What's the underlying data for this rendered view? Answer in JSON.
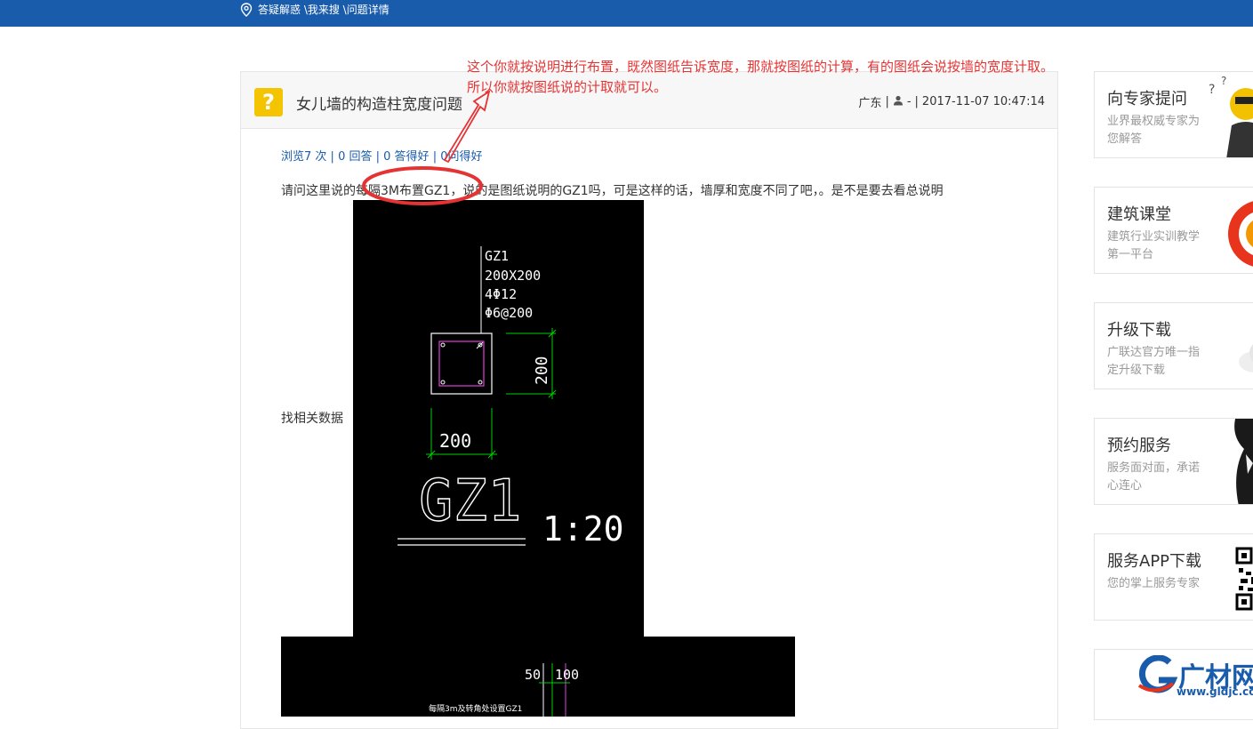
{
  "breadcrumb": {
    "text": "答疑解惑 \\我来搜 \\问题详情"
  },
  "question": {
    "title": "女儿墙的构造柱宽度问题",
    "meta": {
      "location": "广东",
      "sep1": "|",
      "user": "-",
      "sep2": "|",
      "datetime": "2017-11-07 10:47:14"
    },
    "stats": {
      "views": "浏览7 次",
      "answers": "0 回答",
      "good_answers": "0 答得好",
      "asked_good": "0问得好",
      "sep": "|"
    },
    "body_line1": "请问这里说的每隔3M布置GZ1，说的是图纸说明的GZ1吗，可是这样的话，墙厚和宽度不同了吧，。是不是要去看总说明",
    "body_line2": "找相关数据"
  },
  "cad_drawing": {
    "label_name": "GZ1",
    "label_size": "200X200",
    "label_bars": "4Φ12",
    "label_stirrup": "Φ6@200",
    "dim_vertical": "200",
    "dim_horizontal": "200",
    "big_title": "GZ1",
    "scale": "1:20",
    "dim2_a": "50",
    "dim2_b": "100",
    "note2": "每隔3m及转角处设置GZ1"
  },
  "annotation": {
    "line1": "这个你就按说明进行布置，既然图纸告诉宽度，那就按图纸的计算，有的图纸会说按墙的宽度计取。",
    "line2": "所以你就按图纸说的计取就可以。"
  },
  "sidebar": [
    {
      "title": "向专家提问",
      "desc": "业界最权威专家为您解答"
    },
    {
      "title": "建筑课堂",
      "desc": "建筑行业实训教学第一平台"
    },
    {
      "title": "升级下载",
      "desc": "广联达官方唯一指定升级下载"
    },
    {
      "title": "预约服务",
      "desc": "服务面对面，承诺心连心"
    },
    {
      "title": "服务APP下载",
      "desc": "您的掌上服务专家"
    }
  ],
  "logo": {
    "name": "广材网",
    "url": "www.gldjc.com"
  },
  "colors": {
    "topbar": "#1a5cac",
    "annotation": "#e53333",
    "link": "#1a5cac",
    "question_icon": "#f5c400"
  }
}
